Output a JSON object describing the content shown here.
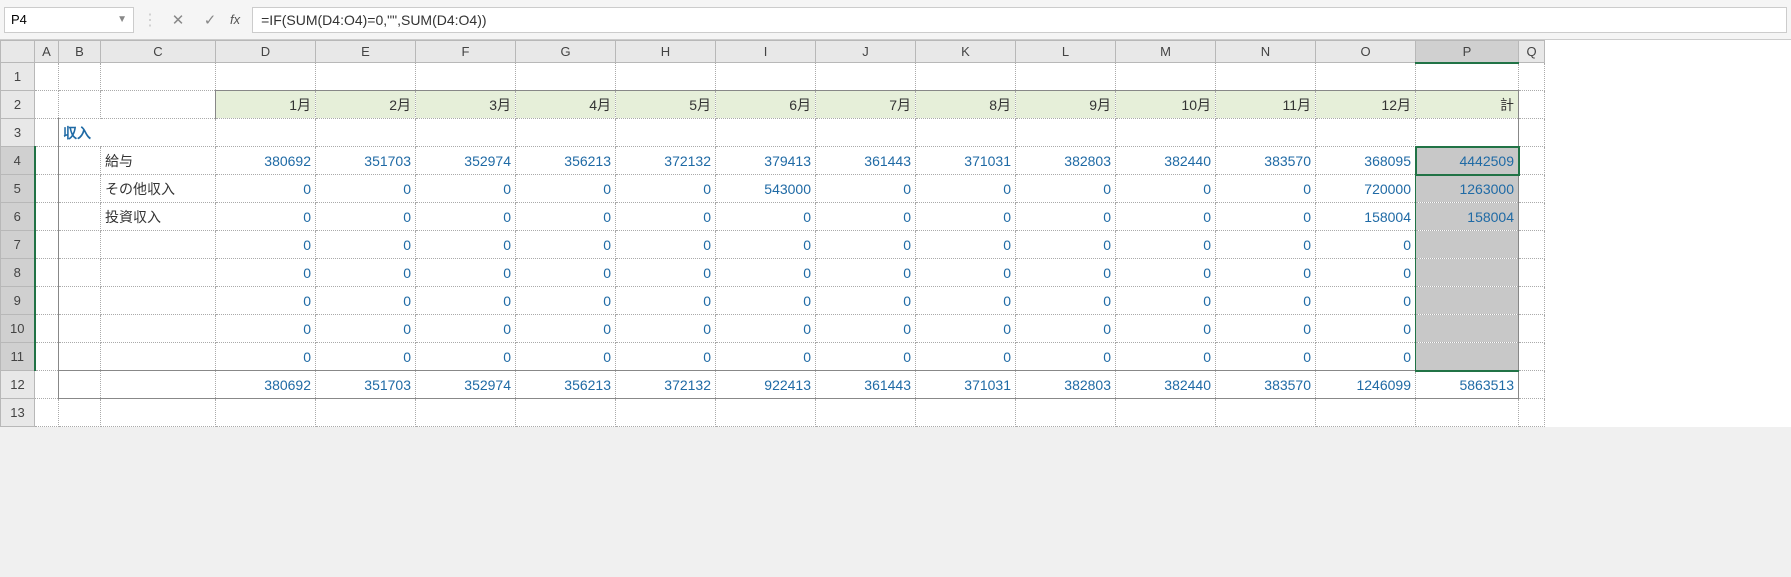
{
  "namebox": "P4",
  "formula": "=IF(SUM(D4:O4)=0,\"\",SUM(D4:O4))",
  "columns": [
    "A",
    "B",
    "C",
    "D",
    "E",
    "F",
    "G",
    "H",
    "I",
    "J",
    "K",
    "L",
    "M",
    "N",
    "O",
    "P",
    "Q"
  ],
  "rows": [
    "1",
    "2",
    "3",
    "4",
    "5",
    "6",
    "7",
    "8",
    "9",
    "10",
    "11",
    "12",
    "13"
  ],
  "headers": {
    "months": [
      "1月",
      "2月",
      "3月",
      "4月",
      "5月",
      "6月",
      "7月",
      "8月",
      "9月",
      "10月",
      "11月",
      "12月"
    ],
    "total": "計"
  },
  "category": "収入",
  "labels": {
    "r4": "給与",
    "r5": "その他収入",
    "r6": "投資収入"
  },
  "data": {
    "r4": [
      "380692",
      "351703",
      "352974",
      "356213",
      "372132",
      "379413",
      "361443",
      "371031",
      "382803",
      "382440",
      "383570",
      "368095",
      "4442509"
    ],
    "r5": [
      "0",
      "0",
      "0",
      "0",
      "0",
      "543000",
      "0",
      "0",
      "0",
      "0",
      "0",
      "720000",
      "1263000"
    ],
    "r6": [
      "0",
      "0",
      "0",
      "0",
      "0",
      "0",
      "0",
      "0",
      "0",
      "0",
      "0",
      "158004",
      "158004"
    ],
    "r7": [
      "0",
      "0",
      "0",
      "0",
      "0",
      "0",
      "0",
      "0",
      "0",
      "0",
      "0",
      "0",
      ""
    ],
    "r8": [
      "0",
      "0",
      "0",
      "0",
      "0",
      "0",
      "0",
      "0",
      "0",
      "0",
      "0",
      "0",
      ""
    ],
    "r9": [
      "0",
      "0",
      "0",
      "0",
      "0",
      "0",
      "0",
      "0",
      "0",
      "0",
      "0",
      "0",
      ""
    ],
    "r10": [
      "0",
      "0",
      "0",
      "0",
      "0",
      "0",
      "0",
      "0",
      "0",
      "0",
      "0",
      "0",
      ""
    ],
    "r11": [
      "0",
      "0",
      "0",
      "0",
      "0",
      "0",
      "0",
      "0",
      "0",
      "0",
      "0",
      "0",
      ""
    ],
    "r12": [
      "380692",
      "351703",
      "352974",
      "356213",
      "372132",
      "922413",
      "361443",
      "371031",
      "382803",
      "382440",
      "383570",
      "1246099",
      "5863513"
    ]
  }
}
